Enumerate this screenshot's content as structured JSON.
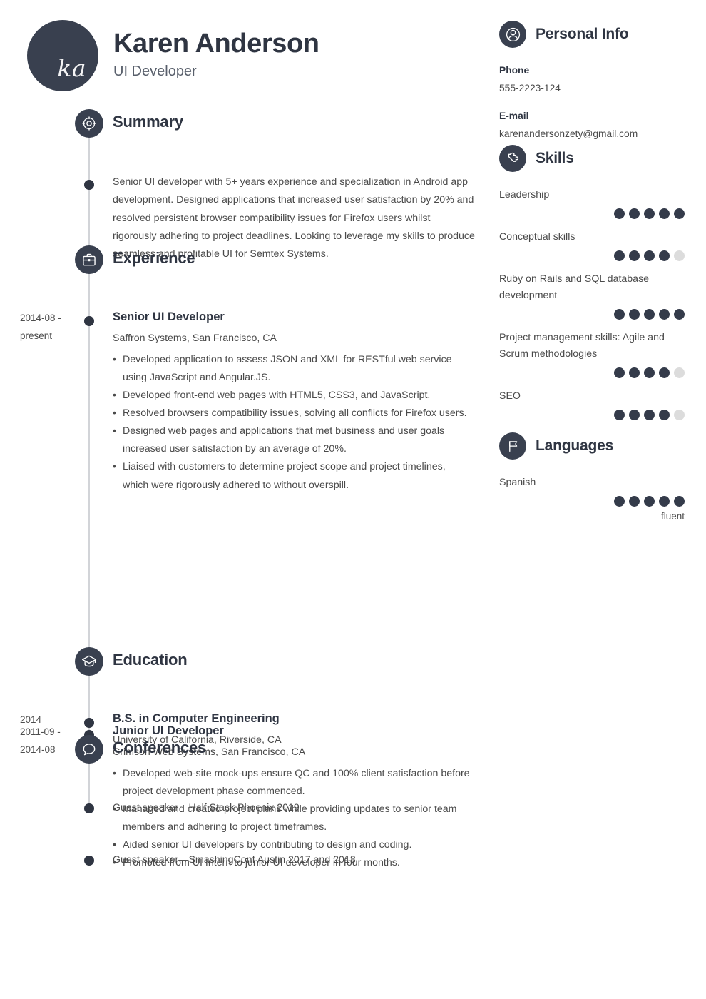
{
  "theme": {
    "dark": "#39404f",
    "text": "#4a4a4a",
    "heading": "#2f3542",
    "dot_filled": "#343b4a",
    "dot_empty": "#dcdcdc",
    "spine": "#d2d4d8"
  },
  "header": {
    "monogram": "ka",
    "name": "Karen Anderson",
    "job_title": "UI Developer"
  },
  "summary": {
    "title": "Summary",
    "icon": "target-icon",
    "text": "Senior UI developer with 5+ years experience and specialization in Android app development. Designed applications that increased user satisfaction by 20% and resolved persistent browser compatibility issues for Firefox users whilst rigorously adhering to project deadlines. Looking to leverage my skills to produce seamless and profitable UI for Semtex Systems."
  },
  "experience": {
    "title": "Experience",
    "icon": "briefcase-icon",
    "jobs": [
      {
        "date": "2014-08 - present",
        "title": "Senior UI Developer",
        "company": "Saffron Systems, San Francisco, CA",
        "bullets": [
          "Developed application to assess JSON and XML for RESTful web service using JavaScript and Angular.JS.",
          "Developed front-end web pages with HTML5, CSS3, and JavaScript.",
          "Resolved browsers compatibility issues, solving all conflicts for Firefox users.",
          "Designed web pages and applications that met business and user goals increased user satisfaction by an average of 20%.",
          "Liaised with customers to determine project scope and project timelines, which were rigorously adhered to without overspill."
        ]
      },
      {
        "date": "2011-09 - 2014-08",
        "title": "Junior UI Developer",
        "company": "Crimson Web Systems, San Francisco, CA",
        "bullets": [
          "Developed web-site mock-ups ensure QC and 100% client satisfaction before project development phase commenced.",
          "Managed and created project plans while providing updates to senior team members and adhering to project timeframes.",
          "Aided senior UI developers by contributing to design and coding.",
          "Promoted from UI Intern to junior UI developer in four months."
        ]
      }
    ]
  },
  "education": {
    "title": "Education",
    "icon": "graduation-cap-icon",
    "entries": [
      {
        "date": "2014",
        "degree": "B.S. in Computer Engineering",
        "school": "University of California, Riverside, CA"
      }
    ]
  },
  "conferences": {
    "title": "Conferences",
    "icon": "speech-bubble-icon",
    "items": [
      "Guest speaker—Half Stack Phoenix 2019",
      "Guest speaker—SmashingConf Austin 2017 and 2018"
    ]
  },
  "personal_info": {
    "title": "Personal Info",
    "icon": "person-icon",
    "fields": [
      {
        "label": "Phone",
        "value": "555-2223-124"
      },
      {
        "label": "E-mail",
        "value": "karenandersonzety@gmail.com"
      }
    ]
  },
  "skills": {
    "title": "Skills",
    "icon": "puzzle-piece-icon",
    "max_rating": 5,
    "items": [
      {
        "name": "Leadership",
        "rating": 5
      },
      {
        "name": "Conceptual skills",
        "rating": 4
      },
      {
        "name": "Ruby on Rails and SQL database development",
        "rating": 5
      },
      {
        "name": "Project management skills: Agile and Scrum methodologies",
        "rating": 4
      },
      {
        "name": "SEO",
        "rating": 4
      }
    ]
  },
  "languages": {
    "title": "Languages",
    "icon": "flag-icon",
    "max_rating": 5,
    "items": [
      {
        "name": "Spanish",
        "rating": 5,
        "level": "fluent"
      }
    ]
  }
}
